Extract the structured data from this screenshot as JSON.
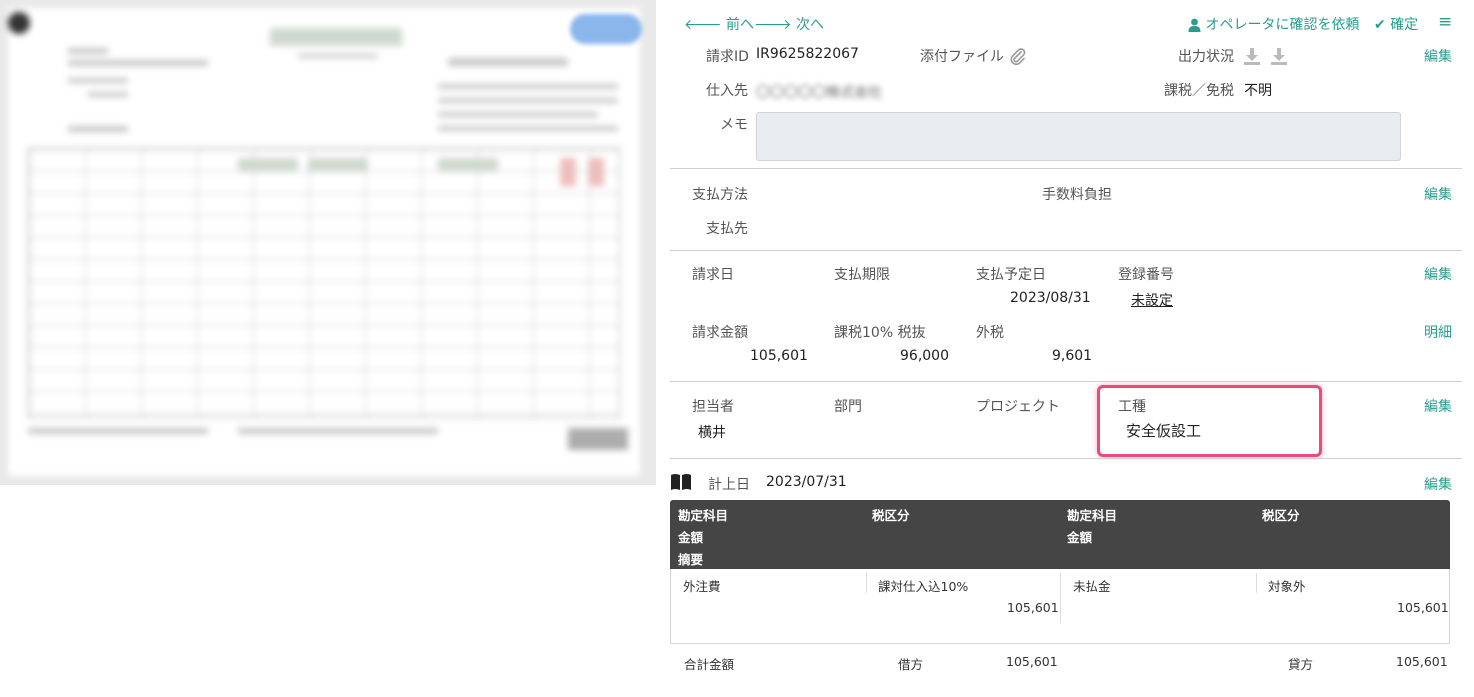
{
  "nav": {
    "prev": "前へ",
    "next": "次へ",
    "ask_operator": "オペレータに確認を依頼",
    "confirm": "確定"
  },
  "edit_label": "編集",
  "detail_label": "明細",
  "basic": {
    "invoice_id_label": "請求ID",
    "invoice_id": "IR9625822067",
    "attachment_label": "添付ファイル",
    "output_status_label": "出力状況",
    "supplier_label": "仕入先",
    "supplier_value": "〇〇〇〇〇株式会社",
    "tax_label": "課税／免税",
    "tax_value": "不明",
    "memo_label": "メモ",
    "memo_value": ""
  },
  "payment": {
    "method_label": "支払方法",
    "fee_label": "手数料負担",
    "payee_label": "支払先"
  },
  "dates": {
    "invoice_date_label": "請求日",
    "due_label": "支払期限",
    "planned_label": "支払予定日",
    "planned_value": "2023/08/31",
    "reg_label": "登録番号",
    "reg_value": "未設定",
    "amount_label": "請求金額",
    "amount_value": "105,601",
    "taxable_label": "課税10% 税抜",
    "taxable_value": "96,000",
    "ext_tax_label": "外税",
    "ext_tax_value": "9,601"
  },
  "assign": {
    "person_label": "担当者",
    "person_value": "横井",
    "dept_label": "部門",
    "project_label": "プロジェクト",
    "work_label": "工種",
    "work_value": "安全仮設工"
  },
  "posting": {
    "label": "計上日",
    "date": "2023/07/31"
  },
  "journal": {
    "head_account": "勘定科目",
    "head_tax": "税区分",
    "head_amount": "金額",
    "head_summary": "摘要",
    "debit_account": "外注費",
    "debit_tax": "課対仕入込10%",
    "debit_amount": "105,601",
    "credit_account": "未払金",
    "credit_tax": "対象外",
    "credit_amount": "105,601",
    "total_label": "合計金額",
    "debit_label": "借方",
    "debit_total": "105,601",
    "credit_label": "貸方",
    "credit_total": "105,601"
  },
  "colors": {
    "accent": "#2a9d8f",
    "highlight": "#ea4a7a",
    "table_header": "#454545"
  }
}
